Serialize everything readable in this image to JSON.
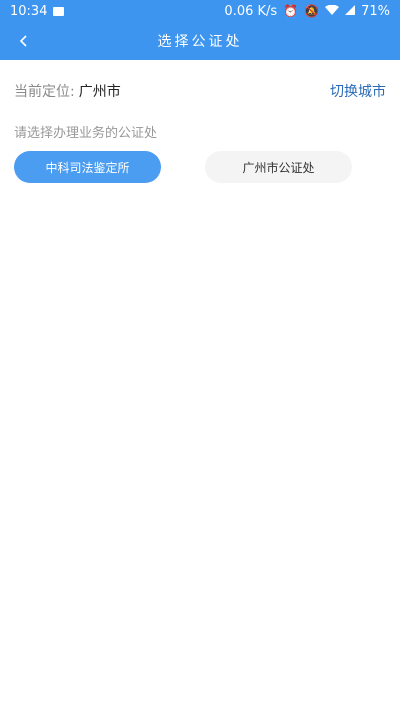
{
  "status_bar": {
    "time": "10:34",
    "net_speed": "0.06 K/s",
    "battery": "71%",
    "icons": [
      "image-icon",
      "alarm-icon",
      "mute-icon",
      "wifi-icon",
      "signal-icon"
    ]
  },
  "header": {
    "title": "选择公证处"
  },
  "location": {
    "label": "当前定位:",
    "city": "广州市",
    "switch_label": "切换城市"
  },
  "hint": "请选择办理业务的公证处",
  "options": [
    {
      "label": "中科司法鉴定所",
      "selected": true
    },
    {
      "label": "广州市公证处",
      "selected": false
    }
  ],
  "colors": {
    "primary": "#3d95f0",
    "selected_button": "#4b9df2",
    "link": "#2a6ab8"
  }
}
